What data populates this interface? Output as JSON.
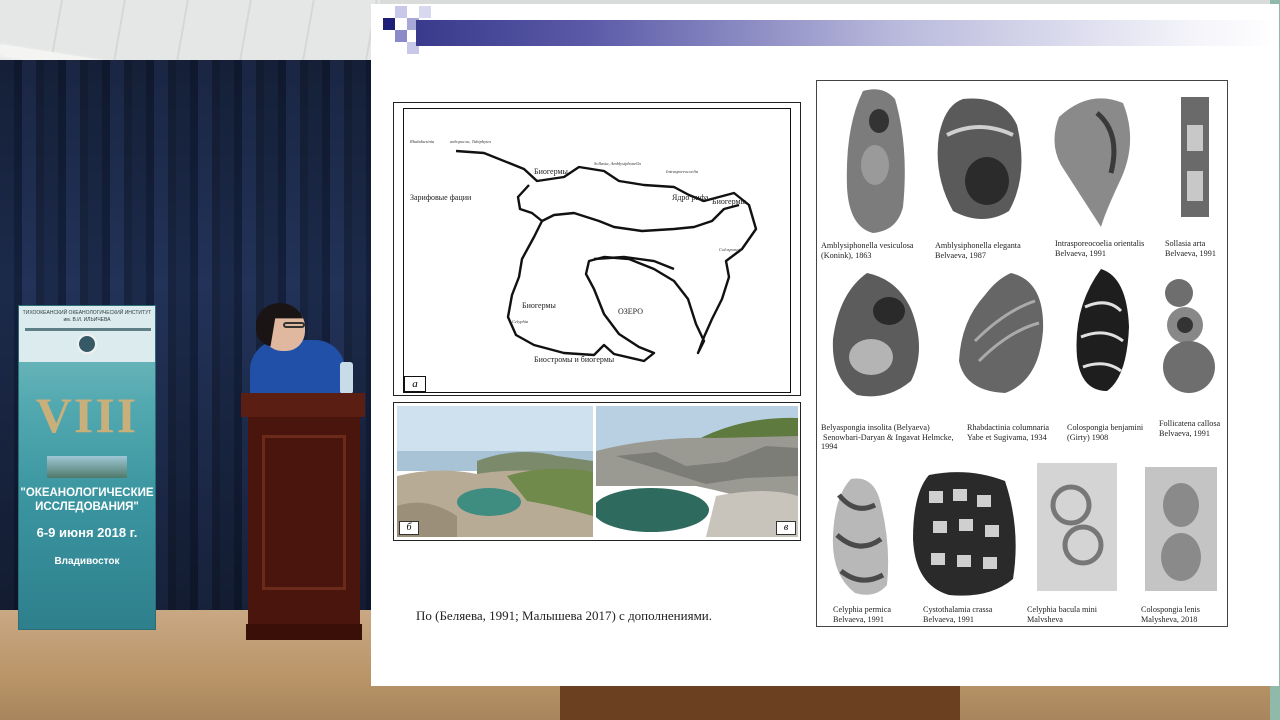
{
  "banner": {
    "header": "ТИХООКЕАНСКИЙ ОКЕАНОЛОГИЧЕСКИЙ ИНСТИТУТ им. В.И. ИЛЬИЧЕВА",
    "numeral": "VIII",
    "title": "\"ОКЕАНОЛОГИЧЕСКИЕ ИССЛЕДОВАНИЯ\"",
    "dates": "6-9 июня 2018 г.",
    "city": "Владивосток"
  },
  "slide": {
    "map": {
      "panel_letter": "а",
      "labels": {
        "biogermy_top": "Биогермы",
        "zarif": "Зарифовые фации",
        "yadro": "Ядро рифа",
        "biogermy_right": "Биогермы",
        "biogermy_left": "Биогермы",
        "ozero": "ОЗЕРО",
        "biostromy": "Биостромы и биогермы"
      },
      "small_notes": [
        "водоросли, Tubiphytes",
        "Sollasia, Amblysiphonella",
        "Intrasporeocoelia",
        "Colospongia",
        "Celyphia",
        "Rhabdactinia"
      ]
    },
    "photos": [
      {
        "letter": "б"
      },
      {
        "letter": "в"
      }
    ],
    "caption": "По (Беляева, 1991; Малышева 2017) с дополнениями.",
    "fossils": [
      {
        "label": "Amblysiphonella vesiculosa\n(Konink), 1863"
      },
      {
        "label": "Amblysiphonella elegantа\nBelvaeva, 1987"
      },
      {
        "label": "Intrasporeocoelia orientalis\nBelvaeva, 1991"
      },
      {
        "label": "Sollasia arta\nBelvaeva, 1991"
      },
      {
        "label": "Belyaspongia insolita (Belyaeva)\n Senowbari-Daryan & Ingavat Helmcke,\n1994"
      },
      {
        "label": "Rhabdactinia columnaria\nYabe et Sugivama, 1934"
      },
      {
        "label": "Colospongia benjamini\n(Girty) 1908"
      },
      {
        "label": "Follicatena callosa\nBelvaeva, 1991"
      },
      {
        "label": "Celyphia permica\nBelvaeva, 1991"
      },
      {
        "label": "Cystothalamia crassa\nBelvaeva, 1991"
      },
      {
        "label": "Celyphia bacula mini\nMalvsheva"
      },
      {
        "label": "Colospongia lenis\nMalysheva, 2018"
      }
    ]
  },
  "colors": {
    "curtain": "#1c2a4a",
    "banner": "#3a95a0",
    "podium": "#4a150c",
    "header_bar": "#3a3a8c",
    "speaker_shirt": "#2050a8"
  }
}
